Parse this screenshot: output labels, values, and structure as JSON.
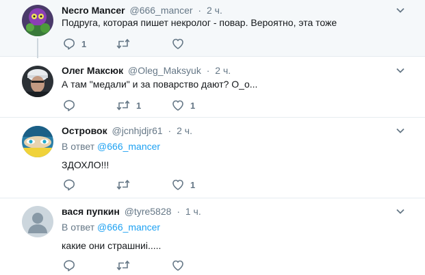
{
  "tweets": [
    {
      "name": "Necro Mancer",
      "handle": "@666_mancer",
      "time": "2 ч.",
      "text": "Подруга, которая пишет некролог - повар. Вероятно, эта тоже",
      "reply_label": "",
      "reply_to": "",
      "counts": {
        "reply": "1",
        "retweet": "",
        "like": ""
      }
    },
    {
      "name": "Олег Максюк",
      "handle": "@Oleg_Maksyuk",
      "time": "2 ч.",
      "text": "А там \"медали\" и за поварство дают? О_о...",
      "reply_label": "",
      "reply_to": "",
      "counts": {
        "reply": "",
        "retweet": "1",
        "like": "1"
      }
    },
    {
      "name": "Островок",
      "handle": "@jcnhjdjr61",
      "time": "2 ч.",
      "text": "ЗДОХЛО!!!",
      "reply_label": "В ответ",
      "reply_to": "@666_mancer",
      "counts": {
        "reply": "",
        "retweet": "",
        "like": "1"
      }
    },
    {
      "name": "вася пупкин",
      "handle": "@tyre5828",
      "time": "1 ч.",
      "text": "какие они страшниі.....",
      "reply_label": "В ответ",
      "reply_to": "@666_mancer",
      "counts": {
        "reply": "",
        "retweet": "",
        "like": ""
      }
    }
  ],
  "separator": "·",
  "icons": {
    "reply": "reply-icon",
    "retweet": "retweet-icon",
    "like": "heart-icon",
    "more": "chevron-down-icon"
  },
  "colors": {
    "highlight_bg": "#f5f8fa",
    "secondary_text": "#657786",
    "link": "#1da1f2"
  }
}
